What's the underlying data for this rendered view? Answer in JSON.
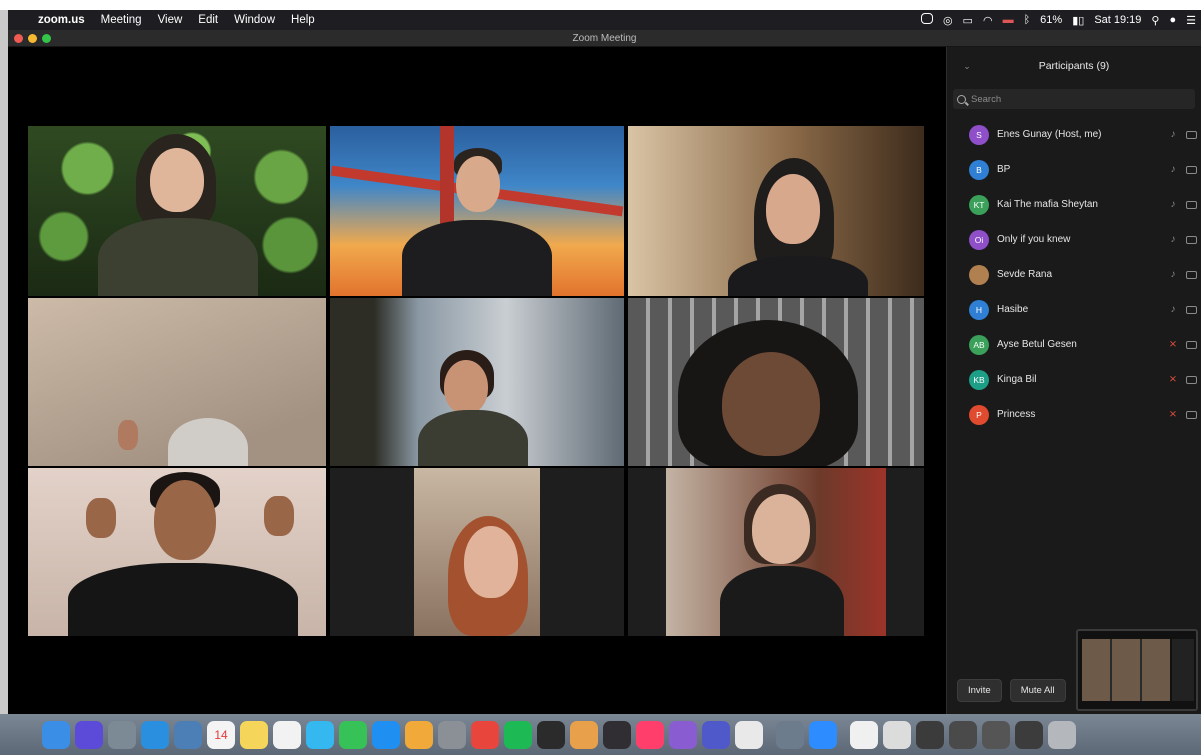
{
  "menubar": {
    "app": "zoom.us",
    "items": [
      "Meeting",
      "View",
      "Edit",
      "Window",
      "Help"
    ],
    "battery": "61%",
    "clock": "Sat 19:19"
  },
  "window": {
    "title": "Zoom Meeting"
  },
  "participants_panel": {
    "title": "Participants (9)",
    "search_placeholder": "Search",
    "participants": [
      {
        "initials": "S",
        "name": "Enes Gunay (Host, me)",
        "color": "#8e4fc9",
        "muted": false
      },
      {
        "initials": "B",
        "name": "BP",
        "color": "#2f7fd4",
        "muted": false
      },
      {
        "initials": "KT",
        "name": "Kai The mafia Sheytan",
        "color": "#3aa05a",
        "muted": false
      },
      {
        "initials": "Oi",
        "name": "Only if you knew",
        "color": "#8e4fc9",
        "muted": false
      },
      {
        "initials": "",
        "name": "Sevde Rana",
        "color": "#b08050",
        "muted": false
      },
      {
        "initials": "H",
        "name": "Hasibe",
        "color": "#2f7fd4",
        "muted": false
      },
      {
        "initials": "AB",
        "name": "Ayse Betul Gesen",
        "color": "#3aa05a",
        "muted": true
      },
      {
        "initials": "KB",
        "name": "Kinga Bil",
        "color": "#1d9e86",
        "muted": true
      },
      {
        "initials": "P",
        "name": "Princess",
        "color": "#e04a2e",
        "muted": true
      }
    ],
    "invite_label": "Invite",
    "mute_all_label": "Mute All"
  },
  "video_tiles": [
    {
      "id": "tile-1",
      "active_speaker": true
    },
    {
      "id": "tile-2",
      "active_speaker": false
    },
    {
      "id": "tile-3",
      "active_speaker": false
    },
    {
      "id": "tile-4",
      "active_speaker": false
    },
    {
      "id": "tile-5",
      "active_speaker": false
    },
    {
      "id": "tile-6",
      "active_speaker": false
    },
    {
      "id": "tile-7",
      "active_speaker": false
    },
    {
      "id": "tile-8",
      "active_speaker": false
    },
    {
      "id": "tile-9",
      "active_speaker": false
    }
  ],
  "dock": {
    "icons": [
      "finder-icon",
      "siri-icon",
      "launchpad-icon",
      "safari-icon",
      "preview-icon",
      "calendar-icon",
      "notes-icon",
      "reminders-icon",
      "messages-icon",
      "facetime-icon",
      "app-store-icon",
      "photos-icon",
      "system-preferences-icon",
      "chrome-icon",
      "spotify-icon",
      "activity-monitor-icon",
      "books-icon",
      "obs-icon",
      "intellij-icon",
      "visual-studio-icon",
      "teams-icon",
      "slack-icon",
      "screenshot-icon",
      "zoom-icon",
      "file-icon",
      "folder-icon",
      "window-icon",
      "window-icon-2",
      "window-icon-3",
      "window-icon-4",
      "trash-icon"
    ],
    "calendar_day": "14"
  },
  "colors": {
    "active_speaker_border": "#d2e35b",
    "muted_mic": "#e0503c"
  }
}
